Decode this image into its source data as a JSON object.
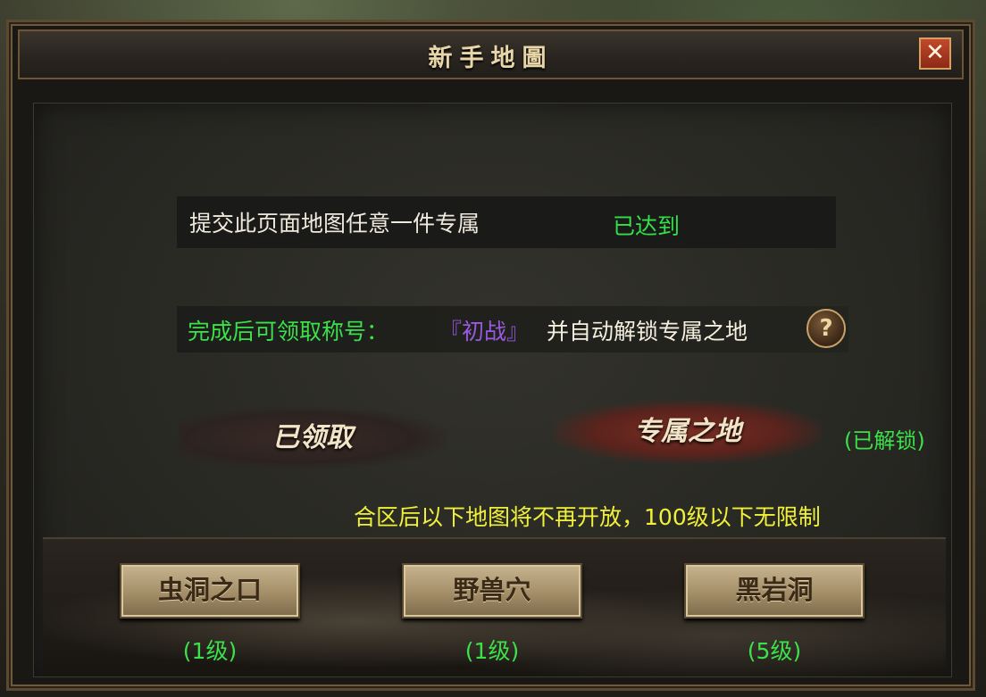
{
  "window": {
    "title": "新手地圖",
    "close_label": "✕"
  },
  "requirement": {
    "text": "提交此页面地图任意一件专属",
    "status": "已达到"
  },
  "reward": {
    "label": "完成后可领取称号：",
    "title": "『初战』",
    "desc": "并自动解锁专属之地",
    "help": "?"
  },
  "actions": {
    "claimed_label": "已领取",
    "exclusive_label": "专属之地",
    "unlocked_note": "(已解锁)"
  },
  "merge_note": "合区后以下地图将不再开放，100级以下无限制",
  "maps": [
    {
      "name": "虫洞之口",
      "level": "(1级)"
    },
    {
      "name": "野兽穴",
      "level": "(1级)"
    },
    {
      "name": "黑岩洞",
      "level": "(5级)"
    }
  ],
  "colors": {
    "green_status": "#33e04a",
    "purple_title": "#9a5ae0",
    "yellow_note": "#f0f03a"
  }
}
